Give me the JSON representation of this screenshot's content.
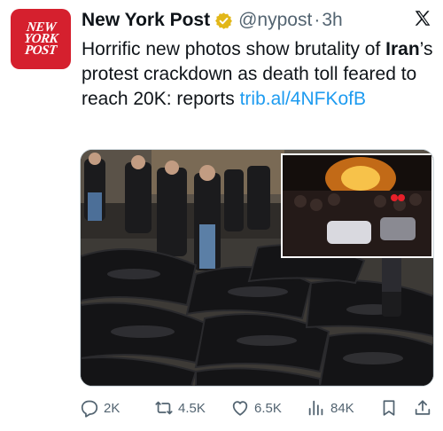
{
  "account": {
    "avatar_text": [
      "NEW",
      "YORK",
      "POST"
    ],
    "name": "New York Post",
    "handle": "@nypost",
    "separator": "·",
    "time": "3h"
  },
  "post": {
    "text_prefix": "Horrific new photos show brutality of ",
    "text_bold": "Iran",
    "text_suffix": "’s protest crackdown as death toll feared to reach 20K: reports ",
    "link": "trib.al/4NFKofB"
  },
  "media": {
    "main_image": "photo of dark body bags in a warehouse with mourners",
    "inset_image": "nighttime street protest with fire"
  },
  "actions": {
    "replies": "2K",
    "reposts": "4.5K",
    "likes": "6.5K",
    "views": "84K"
  },
  "colors": {
    "brand": "#d5202e",
    "link": "#1d9bf0",
    "verified_badge": "#e2b719",
    "muted_text": "#536471"
  },
  "icons": [
    "verified-badge-icon",
    "x-logo-icon",
    "reply-icon",
    "repost-icon",
    "like-icon",
    "views-icon",
    "bookmark-icon",
    "share-icon"
  ]
}
